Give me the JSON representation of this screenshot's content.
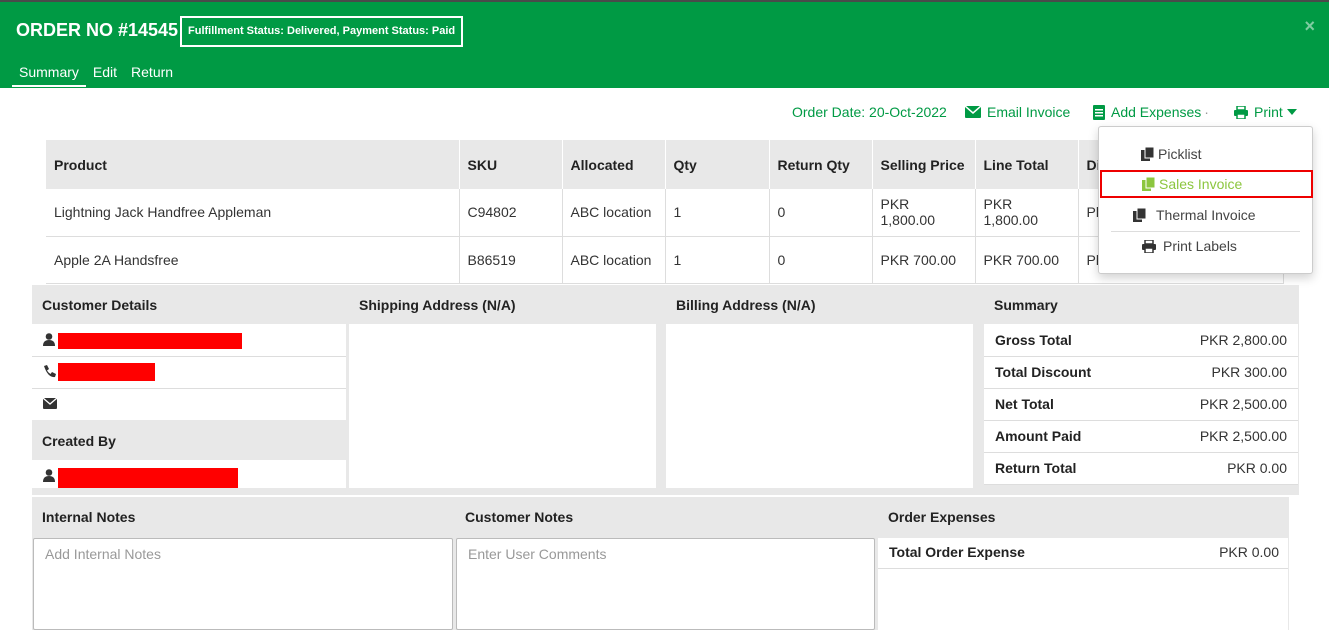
{
  "header": {
    "order_title": "ORDER NO #14545",
    "status_text": "Fulfillment Status: Delivered,  Payment Status: Paid",
    "close": "×",
    "tabs": [
      "Summary",
      "Edit",
      "Return"
    ]
  },
  "actions": {
    "order_date": "Order Date: 20-Oct-2022",
    "email_invoice": "Email Invoice",
    "add_expenses": "Add Expenses",
    "print": "Print"
  },
  "print_menu": {
    "items": [
      "Picklist",
      "Sales Invoice",
      "Thermal Invoice",
      "Print Labels"
    ],
    "highlighted": "Sales Invoice"
  },
  "product_table": {
    "columns": [
      "Product",
      "SKU",
      "Allocated",
      "Qty",
      "Return Qty",
      "Selling Price",
      "Line Total",
      "Di"
    ],
    "rows": [
      [
        "Lightning Jack Handfree Appleman",
        "C94802",
        "ABC location",
        "1",
        "0",
        "PKR 1,800.00",
        "PKR 1,800.00",
        "Pk"
      ],
      [
        "Apple 2A Handsfree",
        "B86519",
        "ABC location",
        "1",
        "0",
        "PKR 700.00",
        "PKR 700.00",
        "Pk"
      ]
    ]
  },
  "customer_details": {
    "title": "Customer Details",
    "created_by_title": "Created By"
  },
  "shipping_address": {
    "title": "Shipping Address (N/A)"
  },
  "billing_address": {
    "title": "Billing Address (N/A)"
  },
  "summary": {
    "title": "Summary",
    "rows": [
      {
        "label": "Gross Total",
        "value": "PKR 2,800.00"
      },
      {
        "label": "Total Discount",
        "value": "PKR 300.00"
      },
      {
        "label": "Net Total",
        "value": "PKR 2,500.00"
      },
      {
        "label": "Amount Paid",
        "value": "PKR 2,500.00"
      },
      {
        "label": "Return Total",
        "value": "PKR 0.00"
      }
    ]
  },
  "internal_notes": {
    "title": "Internal Notes",
    "placeholder": "Add Internal Notes"
  },
  "customer_notes": {
    "title": "Customer Notes",
    "placeholder": "Enter User Comments"
  },
  "order_expenses": {
    "title": "Order Expenses",
    "total_label": "Total Order Expense",
    "total_value": "PKR 0.00"
  },
  "colors": {
    "brand_green": "#009a44",
    "highlight_red": "#ee0000",
    "menu_active": "#8cc63f"
  }
}
